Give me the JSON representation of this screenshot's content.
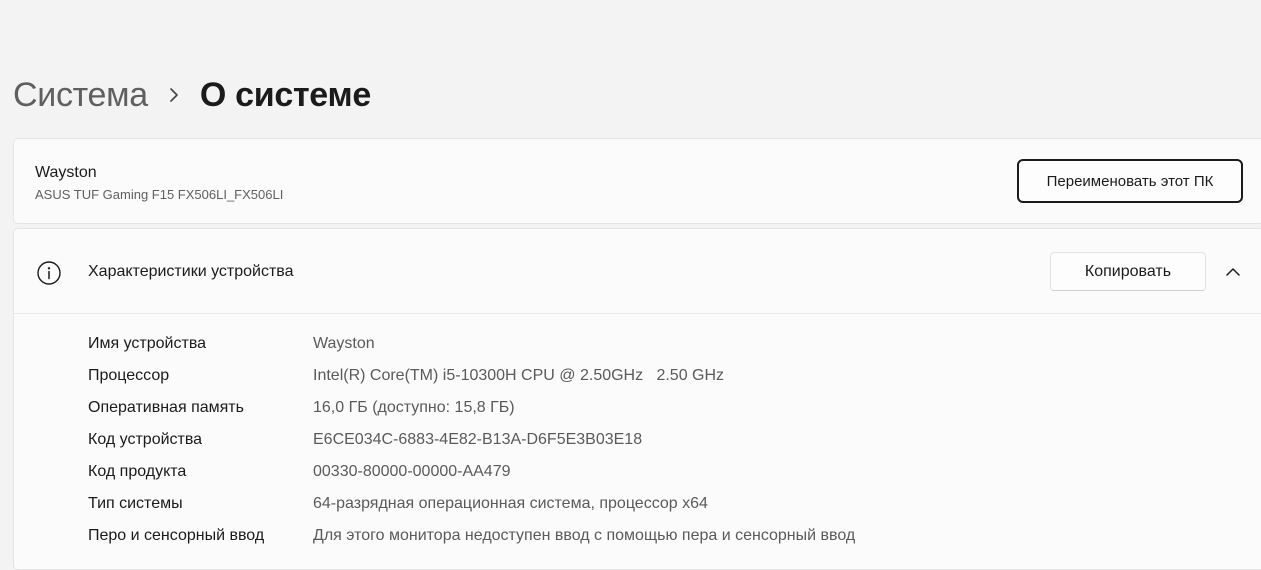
{
  "breadcrumb": {
    "parent": "Система",
    "current": "О системе"
  },
  "device": {
    "name": "Wayston",
    "model": "ASUS TUF Gaming F15 FX506LI_FX506LI",
    "rename_label": "Переименовать этот ПК"
  },
  "specs": {
    "title": "Характеристики устройства",
    "copy_label": "Копировать",
    "rows": [
      {
        "label": "Имя устройства",
        "value": "Wayston"
      },
      {
        "label": "Процессор",
        "value": "Intel(R) Core(TM) i5-10300H CPU @ 2.50GHz   2.50 GHz"
      },
      {
        "label": "Оперативная память",
        "value": "16,0 ГБ (доступно: 15,8 ГБ)"
      },
      {
        "label": "Код устройства",
        "value": "E6CE034C-6883-4E82-B13A-D6F5E3B03E18"
      },
      {
        "label": "Код продукта",
        "value": "00330-80000-00000-AA479"
      },
      {
        "label": "Тип системы",
        "value": "64-разрядная операционная система, процессор x64"
      },
      {
        "label": "Перо и сенсорный ввод",
        "value": "Для этого монитора недоступен ввод с помощью пера и сенсорный ввод"
      }
    ]
  },
  "icons": {
    "breadcrumb_separator": "chevron-right-icon",
    "specs_info": "info-icon",
    "collapse": "chevron-up-icon"
  },
  "colors": {
    "background": "#f3f3f3",
    "card": "#fbfbfb",
    "text_primary": "#1b1b1b",
    "text_secondary": "#5f5f5f",
    "focus_border": "#1b1b1b"
  }
}
